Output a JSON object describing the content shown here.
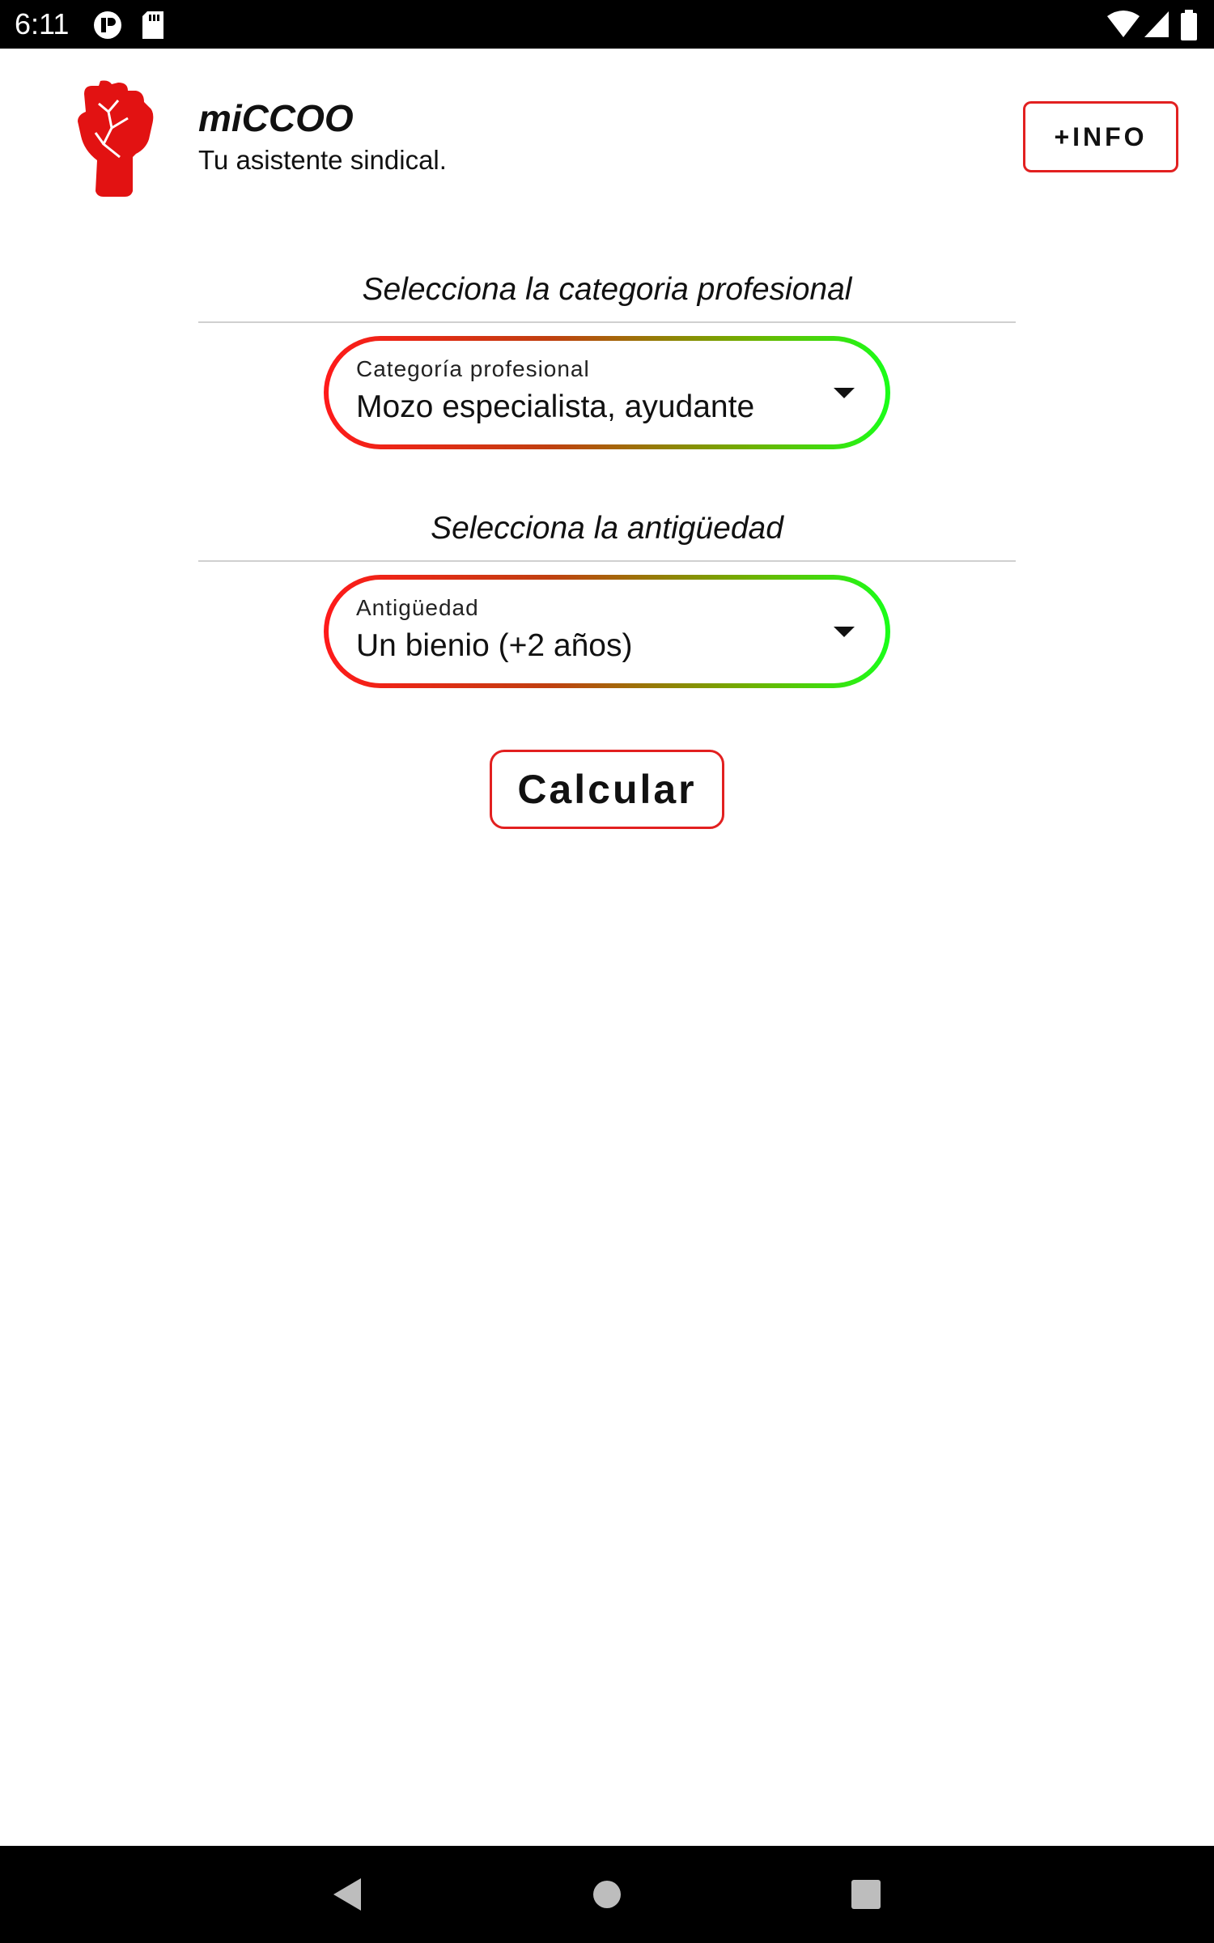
{
  "status_bar": {
    "time": "6:11",
    "icons": [
      "app-notification-icon",
      "sd-card-icon",
      "wifi-icon",
      "signal-icon",
      "battery-icon"
    ]
  },
  "header": {
    "logo_icon": "raised-fist-icon",
    "title": "miCCOO",
    "subtitle": "Tu asistente sindical.",
    "info_button": "+INFO"
  },
  "category_section": {
    "heading": "Selecciona la categoria profesional",
    "dropdown_label": "Categoría profesional",
    "dropdown_value": "Mozo especialista, ayudante"
  },
  "seniority_section": {
    "heading": "Selecciona la antigüedad",
    "dropdown_label": "Antigüedad",
    "dropdown_value": "Un bienio (+2 años)"
  },
  "actions": {
    "calculate_button": "Calcular"
  },
  "nav_bar": {
    "buttons": [
      "back-icon",
      "home-icon",
      "recents-icon"
    ]
  },
  "colors": {
    "accent_red": "#e22020",
    "gradient_start": "#ff1a1a",
    "gradient_end": "#19ff19",
    "system_bars": "#000000"
  }
}
